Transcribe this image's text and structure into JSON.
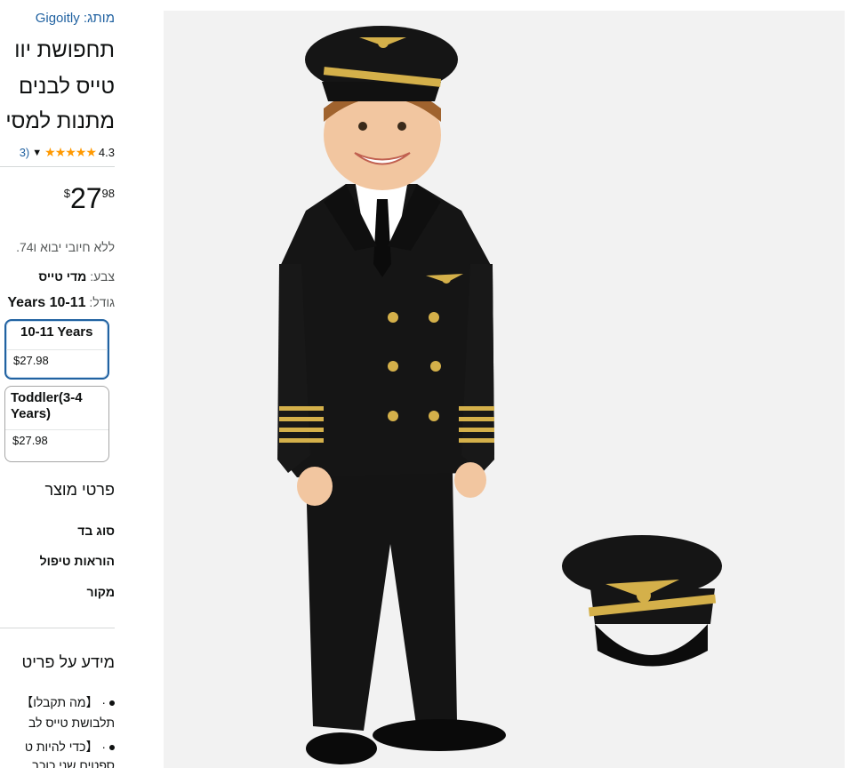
{
  "product": {
    "brand_link": "מותג: Gigoitly",
    "title_lines": [
      "תחפושת יוו",
      "טייס לבנים",
      "מתנות למסי"
    ],
    "rating": {
      "value": "4.3",
      "count_fragment": "(3"
    },
    "price": {
      "symbol": "$",
      "whole": "27",
      "fraction": "98"
    },
    "import_note": "ללא חיובי יבוא ו74."
  },
  "selection": {
    "color_label": "צבע:",
    "color_value": "מדי טייס",
    "size_label": "גודל:",
    "size_value": "10-11 Years"
  },
  "size_options": [
    {
      "label": "10-11 Years",
      "price": "$27.98",
      "selected": true
    },
    {
      "label": "Toddler(3-4 Years)",
      "price": "$27.98",
      "selected": false
    }
  ],
  "product_details": {
    "heading": "פרטי מוצר",
    "rows": [
      "סוג בד",
      "הוראות טיפול",
      "מקור"
    ]
  },
  "about": {
    "heading": "מידע על פריט",
    "bullets": [
      {
        "line1": "· 【מה תקבלו】",
        "line2": "תלבושת טייס לב"
      },
      {
        "line1": "· 【כדי להיות ט",
        "line2": "ספטים שני כוכב"
      }
    ]
  },
  "image": {
    "alt": "Boy in pilot costume with captain hat",
    "colors": {
      "background": "#f2f2f2",
      "suit": "#141414",
      "gold": "#d4b04a",
      "skin": "#f2c6a0"
    }
  }
}
